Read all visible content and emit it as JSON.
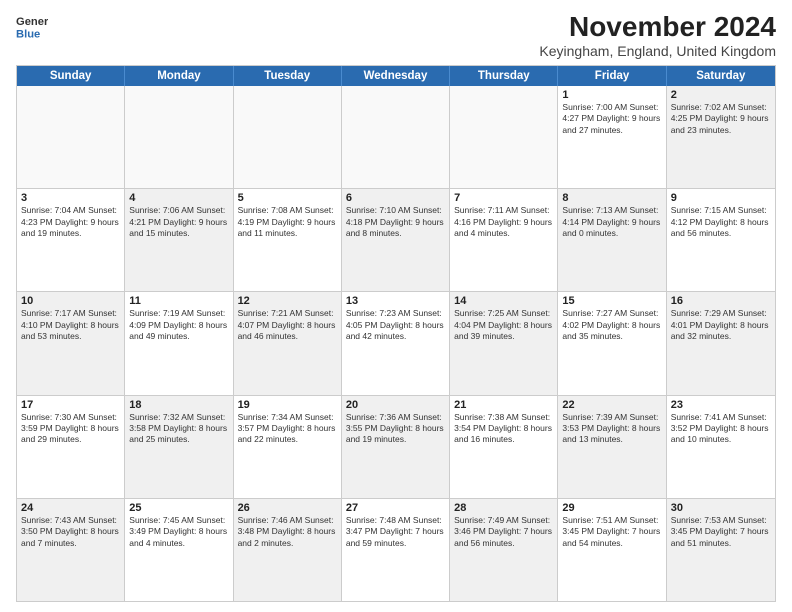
{
  "logo": {
    "general": "General",
    "blue": "Blue"
  },
  "title": "November 2024",
  "location": "Keyingham, England, United Kingdom",
  "header_days": [
    "Sunday",
    "Monday",
    "Tuesday",
    "Wednesday",
    "Thursday",
    "Friday",
    "Saturday"
  ],
  "weeks": [
    [
      {
        "day": "",
        "text": "",
        "empty": true
      },
      {
        "day": "",
        "text": "",
        "empty": true
      },
      {
        "day": "",
        "text": "",
        "empty": true
      },
      {
        "day": "",
        "text": "",
        "empty": true
      },
      {
        "day": "",
        "text": "",
        "empty": true
      },
      {
        "day": "1",
        "text": "Sunrise: 7:00 AM\nSunset: 4:27 PM\nDaylight: 9 hours and 27 minutes.",
        "empty": false
      },
      {
        "day": "2",
        "text": "Sunrise: 7:02 AM\nSunset: 4:25 PM\nDaylight: 9 hours and 23 minutes.",
        "empty": false,
        "shaded": true
      }
    ],
    [
      {
        "day": "3",
        "text": "Sunrise: 7:04 AM\nSunset: 4:23 PM\nDaylight: 9 hours and 19 minutes.",
        "empty": false
      },
      {
        "day": "4",
        "text": "Sunrise: 7:06 AM\nSunset: 4:21 PM\nDaylight: 9 hours and 15 minutes.",
        "empty": false,
        "shaded": true
      },
      {
        "day": "5",
        "text": "Sunrise: 7:08 AM\nSunset: 4:19 PM\nDaylight: 9 hours and 11 minutes.",
        "empty": false
      },
      {
        "day": "6",
        "text": "Sunrise: 7:10 AM\nSunset: 4:18 PM\nDaylight: 9 hours and 8 minutes.",
        "empty": false,
        "shaded": true
      },
      {
        "day": "7",
        "text": "Sunrise: 7:11 AM\nSunset: 4:16 PM\nDaylight: 9 hours and 4 minutes.",
        "empty": false
      },
      {
        "day": "8",
        "text": "Sunrise: 7:13 AM\nSunset: 4:14 PM\nDaylight: 9 hours and 0 minutes.",
        "empty": false,
        "shaded": true
      },
      {
        "day": "9",
        "text": "Sunrise: 7:15 AM\nSunset: 4:12 PM\nDaylight: 8 hours and 56 minutes.",
        "empty": false
      }
    ],
    [
      {
        "day": "10",
        "text": "Sunrise: 7:17 AM\nSunset: 4:10 PM\nDaylight: 8 hours and 53 minutes.",
        "empty": false,
        "shaded": true
      },
      {
        "day": "11",
        "text": "Sunrise: 7:19 AM\nSunset: 4:09 PM\nDaylight: 8 hours and 49 minutes.",
        "empty": false
      },
      {
        "day": "12",
        "text": "Sunrise: 7:21 AM\nSunset: 4:07 PM\nDaylight: 8 hours and 46 minutes.",
        "empty": false,
        "shaded": true
      },
      {
        "day": "13",
        "text": "Sunrise: 7:23 AM\nSunset: 4:05 PM\nDaylight: 8 hours and 42 minutes.",
        "empty": false
      },
      {
        "day": "14",
        "text": "Sunrise: 7:25 AM\nSunset: 4:04 PM\nDaylight: 8 hours and 39 minutes.",
        "empty": false,
        "shaded": true
      },
      {
        "day": "15",
        "text": "Sunrise: 7:27 AM\nSunset: 4:02 PM\nDaylight: 8 hours and 35 minutes.",
        "empty": false
      },
      {
        "day": "16",
        "text": "Sunrise: 7:29 AM\nSunset: 4:01 PM\nDaylight: 8 hours and 32 minutes.",
        "empty": false,
        "shaded": true
      }
    ],
    [
      {
        "day": "17",
        "text": "Sunrise: 7:30 AM\nSunset: 3:59 PM\nDaylight: 8 hours and 29 minutes.",
        "empty": false
      },
      {
        "day": "18",
        "text": "Sunrise: 7:32 AM\nSunset: 3:58 PM\nDaylight: 8 hours and 25 minutes.",
        "empty": false,
        "shaded": true
      },
      {
        "day": "19",
        "text": "Sunrise: 7:34 AM\nSunset: 3:57 PM\nDaylight: 8 hours and 22 minutes.",
        "empty": false
      },
      {
        "day": "20",
        "text": "Sunrise: 7:36 AM\nSunset: 3:55 PM\nDaylight: 8 hours and 19 minutes.",
        "empty": false,
        "shaded": true
      },
      {
        "day": "21",
        "text": "Sunrise: 7:38 AM\nSunset: 3:54 PM\nDaylight: 8 hours and 16 minutes.",
        "empty": false
      },
      {
        "day": "22",
        "text": "Sunrise: 7:39 AM\nSunset: 3:53 PM\nDaylight: 8 hours and 13 minutes.",
        "empty": false,
        "shaded": true
      },
      {
        "day": "23",
        "text": "Sunrise: 7:41 AM\nSunset: 3:52 PM\nDaylight: 8 hours and 10 minutes.",
        "empty": false
      }
    ],
    [
      {
        "day": "24",
        "text": "Sunrise: 7:43 AM\nSunset: 3:50 PM\nDaylight: 8 hours and 7 minutes.",
        "empty": false,
        "shaded": true
      },
      {
        "day": "25",
        "text": "Sunrise: 7:45 AM\nSunset: 3:49 PM\nDaylight: 8 hours and 4 minutes.",
        "empty": false
      },
      {
        "day": "26",
        "text": "Sunrise: 7:46 AM\nSunset: 3:48 PM\nDaylight: 8 hours and 2 minutes.",
        "empty": false,
        "shaded": true
      },
      {
        "day": "27",
        "text": "Sunrise: 7:48 AM\nSunset: 3:47 PM\nDaylight: 7 hours and 59 minutes.",
        "empty": false
      },
      {
        "day": "28",
        "text": "Sunrise: 7:49 AM\nSunset: 3:46 PM\nDaylight: 7 hours and 56 minutes.",
        "empty": false,
        "shaded": true
      },
      {
        "day": "29",
        "text": "Sunrise: 7:51 AM\nSunset: 3:45 PM\nDaylight: 7 hours and 54 minutes.",
        "empty": false
      },
      {
        "day": "30",
        "text": "Sunrise: 7:53 AM\nSunset: 3:45 PM\nDaylight: 7 hours and 51 minutes.",
        "empty": false,
        "shaded": true
      }
    ]
  ]
}
